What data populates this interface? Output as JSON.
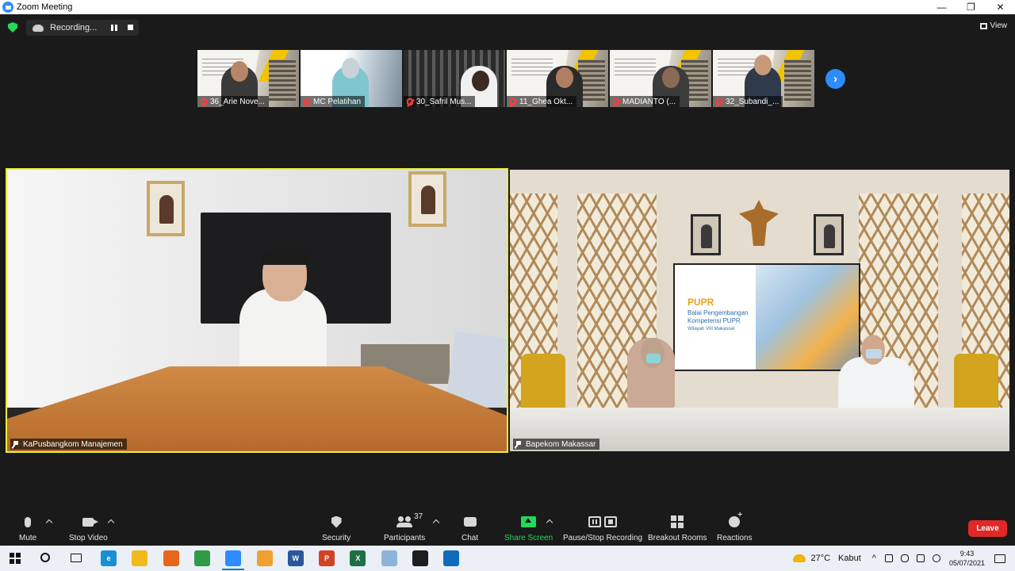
{
  "window": {
    "title": "Zoom Meeting",
    "minimize_label": "—",
    "restore_label": "❐",
    "close_label": "✕"
  },
  "topbar": {
    "recording_label": "Recording...",
    "view_label": "View"
  },
  "thumbnails": [
    {
      "name": "36_Arie Nove...",
      "muted": true
    },
    {
      "name": "MC Pelatihan",
      "muted": true
    },
    {
      "name": "30_Safril Mus...",
      "muted": true
    },
    {
      "name": "11_Ghea Okt...",
      "muted": true
    },
    {
      "name": "MADIANTO (...",
      "muted": true
    },
    {
      "name": "32_Subandi_...",
      "muted": true
    }
  ],
  "videos": {
    "left_name": "KaPusbangkom Manajemen",
    "right_name": "Bapekom Makassar",
    "active_speaker_border_color": "#e6f03c"
  },
  "screen_in_room": {
    "logo": "PU",
    "logo_accent": "PR",
    "line1": "Balai Pengembangan",
    "line2": "Kompetensi PUPR",
    "line3": "Wilayah VIII Makassar"
  },
  "controls": {
    "mute": "Mute",
    "stop_video": "Stop Video",
    "security": "Security",
    "participants": "Participants",
    "participants_count": "37",
    "chat": "Chat",
    "share_screen": "Share Screen",
    "pause_stop_recording": "Pause/Stop Recording",
    "breakout_rooms": "Breakout Rooms",
    "reactions": "Reactions",
    "leave": "Leave"
  },
  "taskbar": {
    "apps": [
      {
        "name": "edge-icon",
        "color": "#1b8fd6",
        "glyph": "e"
      },
      {
        "name": "file-explorer-icon",
        "color": "#f2b91b",
        "glyph": ""
      },
      {
        "name": "firefox-icon",
        "color": "#e8661b",
        "glyph": ""
      },
      {
        "name": "chrome-icon",
        "color": "#2e9b47",
        "glyph": ""
      },
      {
        "name": "zoom-icon",
        "color": "#2d8cff",
        "glyph": ""
      },
      {
        "name": "media-player-icon",
        "color": "#f0a030",
        "glyph": ""
      },
      {
        "name": "word-icon",
        "color": "#2b579a",
        "glyph": "W"
      },
      {
        "name": "powerpoint-icon",
        "color": "#d04423",
        "glyph": "P"
      },
      {
        "name": "excel-icon",
        "color": "#1d7044",
        "glyph": "X"
      },
      {
        "name": "paint-icon",
        "color": "#8db4d8",
        "glyph": ""
      },
      {
        "name": "terminal-icon",
        "color": "#1e1e1e",
        "glyph": ""
      },
      {
        "name": "video-app-icon",
        "color": "#0f6cbd",
        "glyph": ""
      }
    ],
    "temperature": "27°C",
    "weather": "Kabut",
    "time": "9:43",
    "date": "05/07/2021"
  }
}
